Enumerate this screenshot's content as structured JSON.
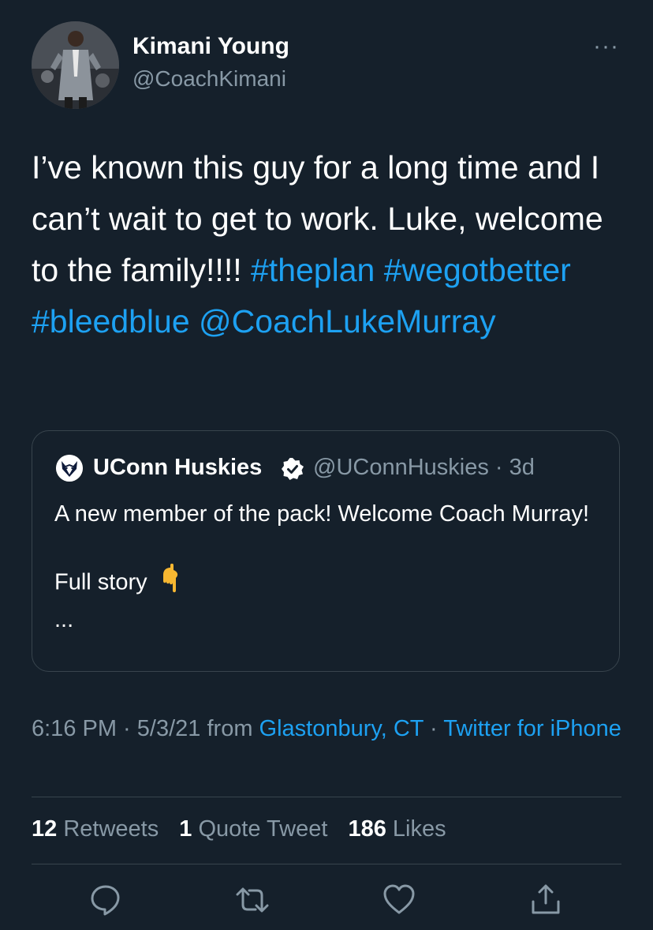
{
  "author": {
    "name": "Kimani Young",
    "handle": "@CoachKimani",
    "more_label": "···"
  },
  "tweet": {
    "text_plain": "I’ve known this guy for a long time and I can’t wait to get to work. Luke, welcome to the family!!!! ",
    "hashtag1": "#theplan",
    "hashtag2": "#wegotbetter",
    "hashtag3": "#bleedblue",
    "mention": "@CoachLukeMurray"
  },
  "quoted": {
    "name": "UConn Huskies",
    "handle_time": "@UConnHuskies · 3d",
    "body": "A new member of the pack! Welcome Coach Murray!\n\nFull story",
    "ellipsis": "...",
    "emoji_icon": "pointing-down-hand-icon"
  },
  "meta": {
    "time": "6:16 PM",
    "sep1": " · ",
    "date": "5/3/21",
    "from": " from ",
    "location": "Glastonbury, CT",
    "sep2": " · ",
    "client": "Twitter for iPhone"
  },
  "stats": {
    "retweets_count": "12",
    "retweets_label": "Retweets",
    "quotes_count": "1",
    "quotes_label": "Quote Tweet",
    "likes_count": "186",
    "likes_label": "Likes"
  },
  "actions": [
    "reply-icon",
    "retweet-icon",
    "like-icon",
    "share-icon"
  ],
  "colors": {
    "background": "#15202b",
    "link": "#1da1f2",
    "secondary_text": "#8899a6",
    "border": "#38444d"
  }
}
